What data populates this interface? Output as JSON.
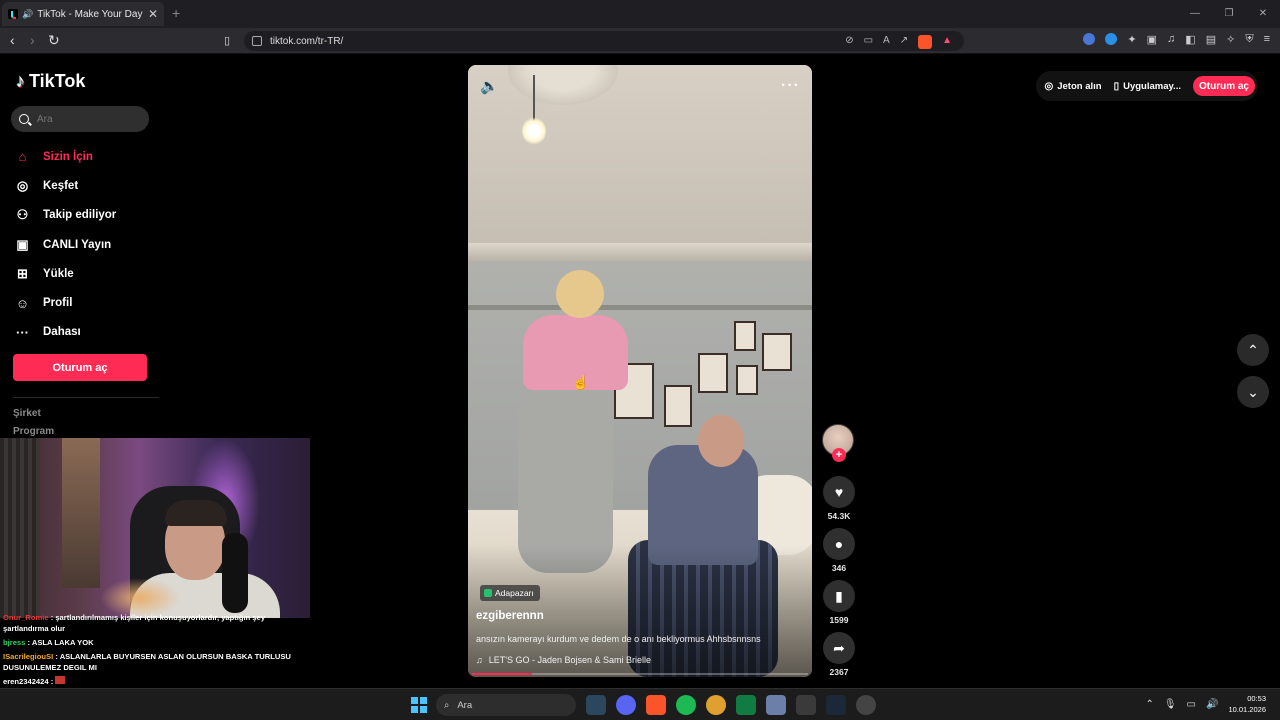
{
  "browser": {
    "tab_title": "TikTok - Make Your Day",
    "tab_close": "✕",
    "new_tab": "+",
    "url": "tiktok.com/tr-TR/"
  },
  "sidebar": {
    "logo": "TikTok",
    "search_placeholder": "Ara",
    "items": [
      {
        "label": "Sizin İçin",
        "icon": "home-icon"
      },
      {
        "label": "Keşfet",
        "icon": "compass-icon"
      },
      {
        "label": "Takip ediliyor",
        "icon": "following-icon"
      },
      {
        "label": "CANLI Yayın",
        "icon": "live-icon"
      },
      {
        "label": "Yükle",
        "icon": "upload-icon"
      },
      {
        "label": "Profil",
        "icon": "profile-icon"
      },
      {
        "label": "Dahası",
        "icon": "more-icon"
      }
    ],
    "login_button": "Oturum aç",
    "footer": [
      "Şirket",
      "Program"
    ]
  },
  "header_right": {
    "coins": "Jeton alın",
    "app": "Uygulamay...",
    "login": "Oturum aç"
  },
  "video": {
    "location": "Adapazarı",
    "username": "ezgiberennn",
    "description": "ansızın kamerayı kurdum ve dedem de o anı bekliyormus Ahhsbsnnsns",
    "music": "LET'S GO - Jaden Bojsen & Sami Brielle",
    "progress": 0.18,
    "likes": "54.3K",
    "comments": "346",
    "saves": "1599",
    "shares": "2367"
  },
  "stream_chat": [
    {
      "user": "Onur_Romie",
      "msg": "şartlandırılmamış kişiler için konuşuyorlardır, yaptığın şey şartlandırma olur",
      "color": "red"
    },
    {
      "user": "bjress",
      "msg": "ASLA LAKA YOK",
      "color": "green"
    },
    {
      "user": "ISacrilegiouSI",
      "msg": "ASLANLARLA BUYURSEN ASLAN OLURSUN BASKA TURLUSU DUSUNULEMEZ DEGIL MI",
      "color": "orange"
    },
    {
      "user": "eren2342424",
      "msg": "",
      "color": "white"
    }
  ],
  "taskbar": {
    "search": "Ara",
    "time": "00:53",
    "date": "10.01.2026"
  },
  "colors": {
    "accent": "#fe2c55",
    "background": "#000000"
  }
}
